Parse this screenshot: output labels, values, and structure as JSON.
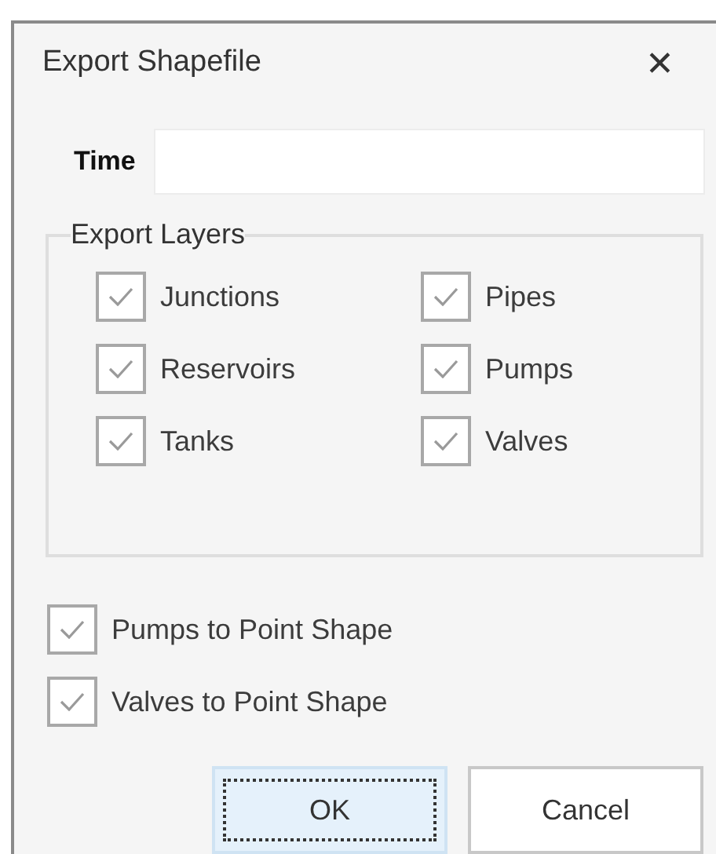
{
  "window": {
    "title": "Export Shapefile",
    "close": "✕"
  },
  "time": {
    "label": "Time"
  },
  "export_layers": {
    "title": "Export Layers",
    "items": [
      {
        "label": "Junctions",
        "checked": true
      },
      {
        "label": "Pipes",
        "checked": true
      },
      {
        "label": "Reservoirs",
        "checked": true
      },
      {
        "label": "Pumps",
        "checked": true
      },
      {
        "label": "Tanks",
        "checked": true
      },
      {
        "label": "Valves",
        "checked": true
      }
    ]
  },
  "options": [
    {
      "label": "Pumps to Point Shape",
      "checked": true
    },
    {
      "label": "Valves to Point Shape",
      "checked": true
    }
  ],
  "buttons": [
    {
      "label": "OK",
      "focused": true
    },
    {
      "label": "Cancel",
      "focused": false
    }
  ]
}
